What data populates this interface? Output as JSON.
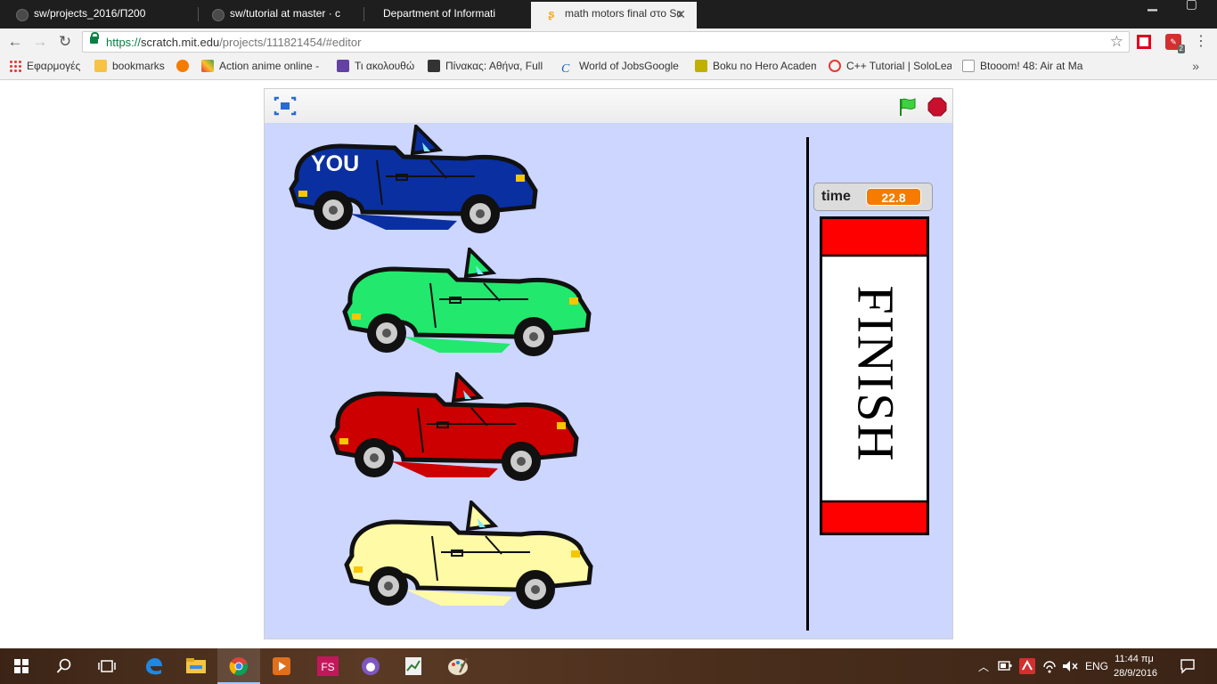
{
  "browser": {
    "tabs": [
      {
        "title": "sw/projects_2016/Π200"
      },
      {
        "title": "sw/tutorial at master · c"
      },
      {
        "title": "Department of Informati"
      },
      {
        "title": "math motors final στο Sc",
        "active": true
      }
    ],
    "url_scheme": "https://",
    "url_host": "scratch.mit.edu",
    "url_path": "/projects/111821454/#editor",
    "extension_badge_count": "2",
    "bookmarks": [
      {
        "label": "Εφαρμογές",
        "icon": "apps-icon"
      },
      {
        "label": "bookmarks",
        "icon": "folder-icon"
      },
      {
        "label": "",
        "icon": "site-icon-orange"
      },
      {
        "label": "Action anime online -",
        "icon": "site-icon-multicolor"
      },
      {
        "label": "Τι ακολουθώ",
        "icon": "twitch-icon"
      },
      {
        "label": "Πίνακας: Αθήνα, Full",
        "icon": "cat-icon"
      },
      {
        "label": "World of JobsGoogle",
        "icon": "c-icon"
      },
      {
        "label": "Boku no Hero Academ",
        "icon": "site-icon-yellow"
      },
      {
        "label": "C++ Tutorial | SoloLea",
        "icon": "sololearn-icon"
      },
      {
        "label": "Btooom! 48: Air at Ma",
        "icon": "page-icon"
      }
    ]
  },
  "scratch": {
    "car_label": "YOU",
    "variable": {
      "name": "time",
      "value": "22.8"
    },
    "finish_text": "FINISH",
    "colors": {
      "stage_bg": "#ccd6ff",
      "car_player": "#0a2fa0",
      "car_green": "#22e86e",
      "car_red": "#cc0000",
      "car_yellow": "#fffaa5",
      "finish_red": "#ff0000",
      "monitor_value": "#f57c00"
    }
  },
  "taskbar": {
    "time": "11:44 πμ",
    "date": "28/9/2016",
    "language": "ENG",
    "apps": [
      "edge-icon",
      "file-explorer-icon",
      "chrome-icon",
      "media-player-icon",
      "fs-app-icon",
      "twitch-app-icon",
      "notepad-chart-icon",
      "paint-icon"
    ]
  }
}
